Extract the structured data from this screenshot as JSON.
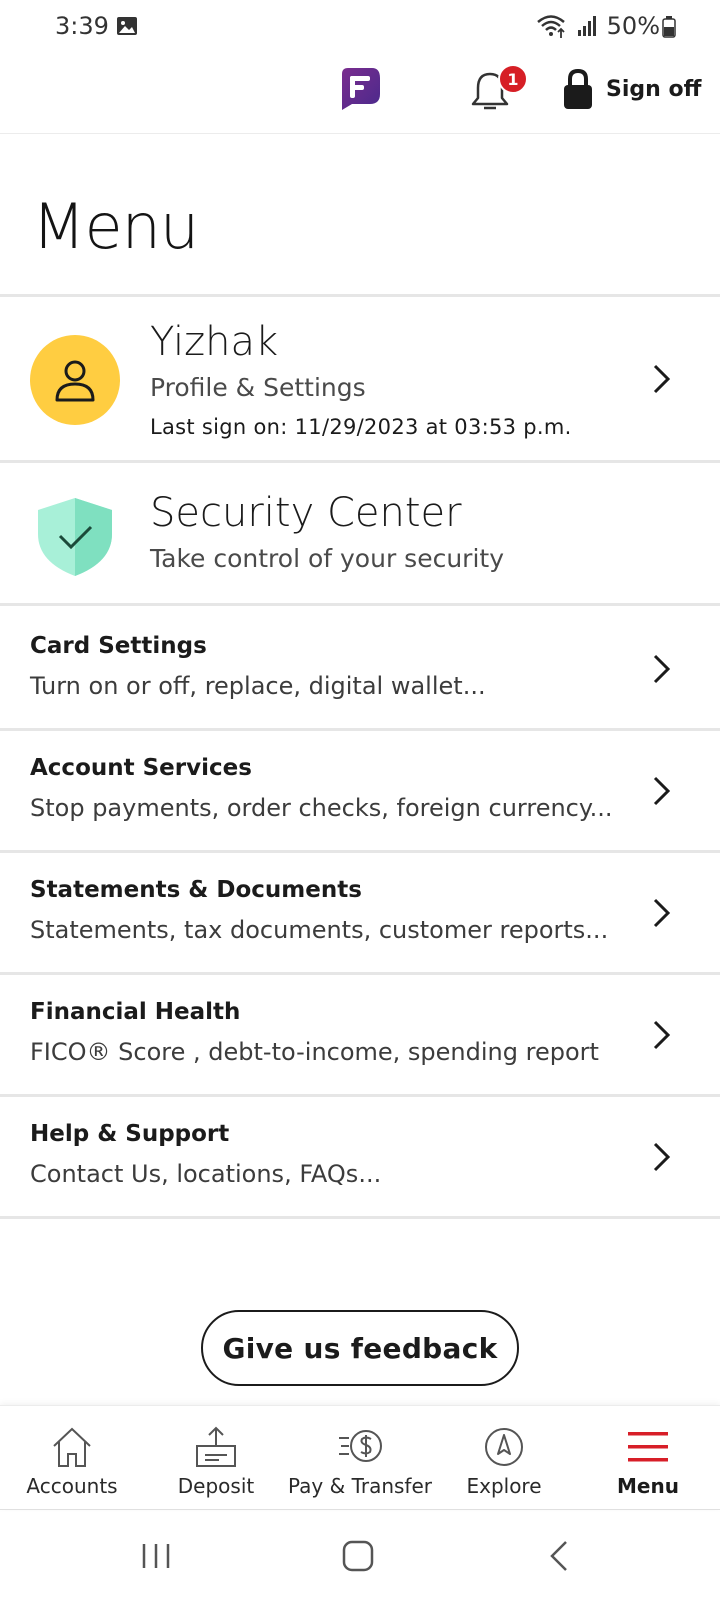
{
  "status_bar": {
    "time": "3:39",
    "battery": "50%",
    "icons": [
      "image-icon",
      "wifi-icon",
      "signal-icon",
      "battery-icon"
    ]
  },
  "header": {
    "logo_icon": "fargo-assistant-icon",
    "notification_count": "1",
    "sign_off_label": "Sign off"
  },
  "page": {
    "title": "Menu"
  },
  "profile": {
    "name": "Yizhak",
    "subtitle": "Profile & Settings",
    "last_sign_on": "Last sign on: 11/29/2023 at 03:53 p.m.",
    "avatar_color": "#ffcd41"
  },
  "security": {
    "title": "Security Center",
    "subtitle": "Take control of your security",
    "shield_color": "#7fe0c0"
  },
  "menu_items": [
    {
      "title": "Card Settings",
      "subtitle": "Turn on or off, replace, digital wallet..."
    },
    {
      "title": "Account Services",
      "subtitle": "Stop payments, order checks, foreign currency..."
    },
    {
      "title": "Statements & Documents",
      "subtitle": "Statements, tax documents, customer reports..."
    },
    {
      "title": "Financial Health",
      "subtitle": "FICO® Score , debt-to-income, spending report"
    },
    {
      "title": "Help & Support",
      "subtitle": "Contact Us, locations, FAQs..."
    }
  ],
  "feedback": {
    "label": "Give us feedback"
  },
  "bottom_nav": [
    {
      "label": "Accounts",
      "icon": "home-icon",
      "active": false
    },
    {
      "label": "Deposit",
      "icon": "deposit-icon",
      "active": false
    },
    {
      "label": "Pay & Transfer",
      "icon": "pay-transfer-icon",
      "active": false
    },
    {
      "label": "Explore",
      "icon": "compass-icon",
      "active": false
    },
    {
      "label": "Menu",
      "icon": "hamburger-menu-icon",
      "active": true
    }
  ],
  "colors": {
    "accent_red": "#d61f26",
    "menu_active_red": "#d71e28",
    "badge_red": "#d61f26",
    "logo_purple": "#5a2b8c"
  }
}
